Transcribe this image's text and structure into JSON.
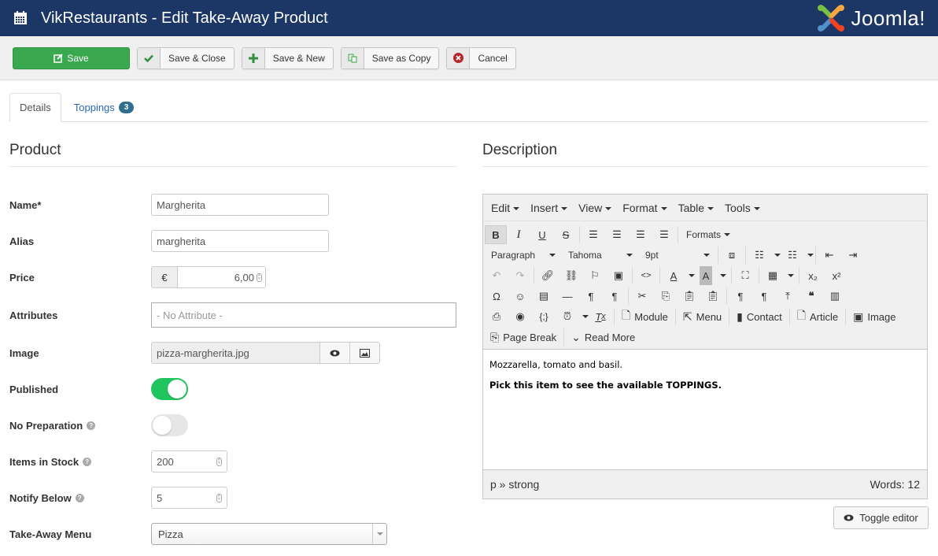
{
  "header": {
    "title": "VikRestaurants - Edit Take-Away Product",
    "icon": "calendar-icon",
    "brand": "Joomla!"
  },
  "toolbar": {
    "save_label": "Save",
    "save_close_label": "Save & Close",
    "save_new_label": "Save & New",
    "save_copy_label": "Save as Copy",
    "cancel_label": "Cancel"
  },
  "tabs": [
    {
      "label": "Details",
      "active": true
    },
    {
      "label": "Toppings",
      "badge": "3",
      "active": false
    }
  ],
  "product": {
    "section_title": "Product",
    "fields": {
      "name": {
        "label": "Name*",
        "value": "Margherita"
      },
      "alias": {
        "label": "Alias",
        "value": "margherita"
      },
      "price": {
        "label": "Price",
        "currency": "€",
        "value": "6,00"
      },
      "attributes": {
        "label": "Attributes",
        "placeholder": "- No Attribute -"
      },
      "image": {
        "label": "Image",
        "value": "pizza-margherita.jpg"
      },
      "published": {
        "label": "Published",
        "value": true
      },
      "no_preparation": {
        "label": "No Preparation",
        "value": false
      },
      "items_in_stock": {
        "label": "Items in Stock",
        "value": "200"
      },
      "notify_below": {
        "label": "Notify Below",
        "value": "5"
      },
      "takeaway_menu": {
        "label": "Take-Away Menu",
        "value": "Pizza"
      }
    }
  },
  "description": {
    "section_title": "Description",
    "menubar": [
      "Edit",
      "Insert",
      "View",
      "Format",
      "Table",
      "Tools"
    ],
    "formats_label": "Formats",
    "block_format": "Paragraph",
    "font_family": "Tahoma",
    "font_size": "9pt",
    "buttons": {
      "module": "Module",
      "menu": "Menu",
      "contact": "Contact",
      "article": "Article",
      "image": "Image",
      "page_break": "Page Break",
      "read_more": "Read More"
    },
    "content": {
      "line1": "Mozzarella, tomato and basil.",
      "line2": "Pick this item to see the available TOPPINGS."
    },
    "status_path": "p » strong",
    "word_count": "Words: 12",
    "toggle_editor_label": "Toggle editor"
  },
  "colors": {
    "header_bg": "#1c3765",
    "save_green": "#3aa84f",
    "toggle_on": "#1fc65f",
    "badge_bg": "#2f6e8c",
    "link_blue": "#2a69b8"
  }
}
